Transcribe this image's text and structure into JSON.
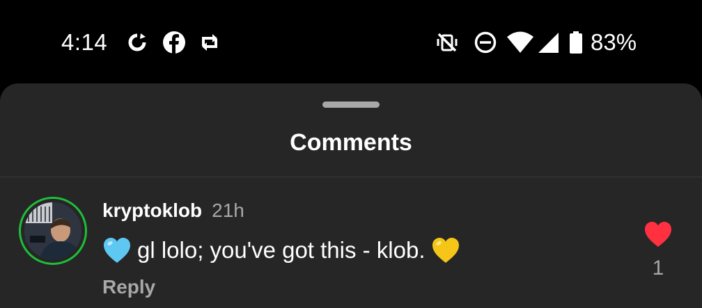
{
  "status_bar": {
    "time": "4:14",
    "battery_percent": "83%",
    "left_icons": [
      "sync-icon",
      "facebook-icon",
      "repost-icon"
    ],
    "right_icons": [
      "vibrate-off-icon",
      "do-not-disturb-icon",
      "wifi-icon",
      "cellular-signal-icon",
      "battery-icon"
    ]
  },
  "sheet": {
    "title": "Comments"
  },
  "comments": [
    {
      "username": "kryptoklob",
      "timestamp": "21h",
      "text": "gl lolo; you've got this - klob.",
      "leading_emoji": "blue-heart",
      "trailing_emoji": "yellow-heart",
      "reply_label": "Reply",
      "like_count": "1",
      "liked": true
    }
  ],
  "colors": {
    "background": "#000000",
    "sheet": "#262626",
    "secondary_text": "#a8a8a8",
    "avatar_ring": "#1dbf3a",
    "like_red": "#ff3040",
    "blue_heart": "#5ec8f2",
    "yellow_heart": "#f5c518"
  }
}
